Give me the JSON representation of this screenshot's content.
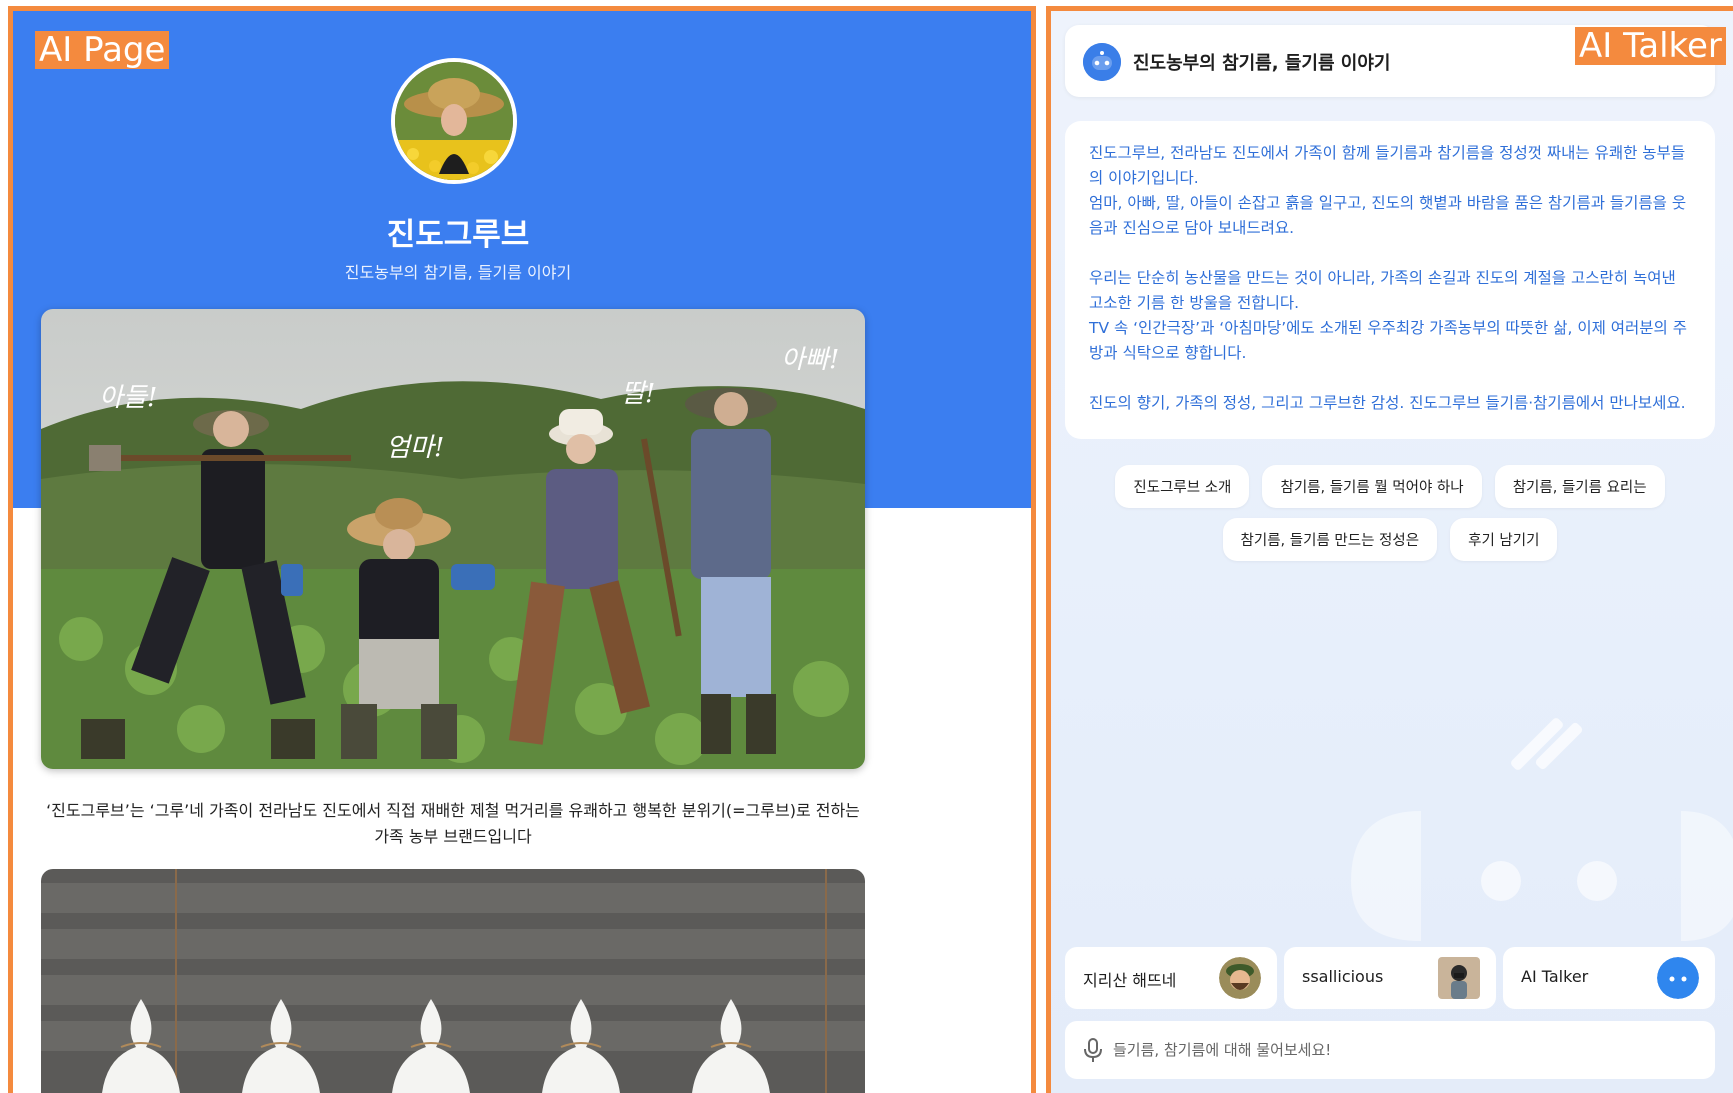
{
  "annotations": {
    "left_tag": "AI Page",
    "right_tag": "AI Talker"
  },
  "ai_page": {
    "brand_name": "진도그루브",
    "subtitle": "진도농부의 참기름, 들기름 이야기",
    "photo_labels": {
      "son": "아들!",
      "mom": "엄마!",
      "daughter": "딸!",
      "dad": "아빠!"
    },
    "caption": "‘진도그루브’는 ‘그루’네 가족이 전라남도 진도에서 직접 재배한 제철 먹거리를 유쾌하고 행복한 분위기(=그루브)로 전하는 가족 농부 브랜드입니다"
  },
  "ai_talker": {
    "header_title": "진도농부의 참기름, 들기름 이야기",
    "message_paragraphs": [
      [
        "진도그루브, 전라남도 진도에서 가족이 함께 들기름과 참기름을 정성껏 짜내는 유쾌한 농부들의 이야기입니다.",
        "엄마, 아빠, 딸, 아들이 손잡고 흙을 일구고, 진도의 햇볕과 바람을 품은 참기름과 들기름을 웃음과 진심으로 담아 보내드려요."
      ],
      [
        "우리는 단순히 농산물을 만드는 것이 아니라, 가족의 손길과 진도의 계절을 고스란히 녹여낸 고소한 기름 한 방울을 전합니다.",
        "TV 속 ‘인간극장’과 ‘아침마당’에도 소개된 우주최강 가족농부의 따뜻한 삶, 이제 여러분의 주방과 식탁으로 향합니다."
      ],
      [
        "진도의 향기, 가족의 정성, 그리고 그루브한 감성. 진도그루브 들기름·참기름에서 만나보세요."
      ]
    ],
    "chips": [
      "진도그루브 소개",
      "참기름, 들기름 뭘 먹어야 하나",
      "참기름, 들기름 요리는",
      "참기름, 들기름 만드는 정성은",
      "후기 남기기"
    ],
    "bots": [
      {
        "name": "지리산 해뜨네",
        "icon": "avatar-bearded-man-icon"
      },
      {
        "name": "ssallicious",
        "icon": "avatar-woman-photo-icon"
      },
      {
        "name": "AI Talker",
        "icon": "ai-talker-robot-icon"
      }
    ],
    "input_placeholder": "들기름, 참기름에 대해 물어보세요!"
  },
  "colors": {
    "accent_blue": "#3b7ef0",
    "annotation_orange": "#f48a3e",
    "message_text_blue": "#2f6fd8"
  }
}
